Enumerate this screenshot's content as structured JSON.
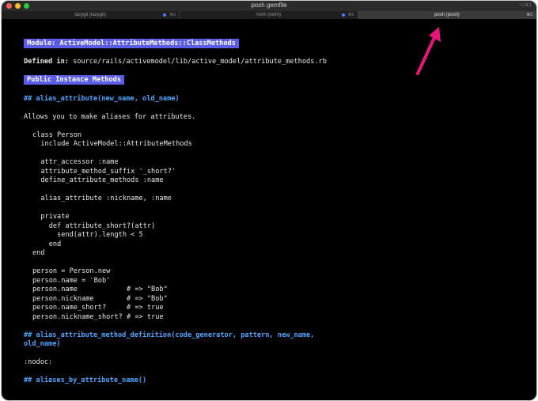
{
  "window": {
    "title": "posh gemfile",
    "shortcut": "⌥⌘1"
  },
  "tabs": [
    {
      "label": "lazygit (lazygit)",
      "shortcut": "⌘1",
      "active": false
    },
    {
      "label": "nvim (nvim)",
      "shortcut": "⌘2",
      "active": false
    },
    {
      "label": "posh (posh)",
      "shortcut": "⌘3",
      "active": true
    }
  ],
  "doc": {
    "module_badge": "Module: ActiveModel::AttributeMethods::ClassMethods",
    "defined_label": "Defined in:",
    "defined_path": "source/rails/activemodel/lib/active_model/attribute_methods.rb",
    "section_badge": "Public Instance Methods",
    "heading1": "## alias_attribute(new_name, old_name)",
    "description": "Allows you to make aliases for attributes.",
    "code": [
      "class Person",
      "  include ActiveModel::AttributeMethods",
      "",
      "  attr_accessor :name",
      "  attribute_method_suffix '_short?'",
      "  define_attribute_methods :name",
      "",
      "  alias_attribute :nickname, :name",
      "",
      "  private",
      "    def attribute_short?(attr)",
      "      send(attr).length < 5",
      "    end",
      "end",
      "",
      "person = Person.new",
      "person.name = 'Bob'",
      "person.name            # => \"Bob\"",
      "person.nickname        # => \"Bob\"",
      "person.name_short?     # => true",
      "person.nickname_short? # => true"
    ],
    "heading2_line1": "## alias_attribute_method_definition(code_generator, pattern, new_name,",
    "heading2_line2": "old_name)",
    "nodoc": ":nodoc:",
    "heading3": "## aliases_by_attribute_name()"
  },
  "colors": {
    "badge": "#5b5de8",
    "heading": "#4fa6ff",
    "arrow": "#e8157a",
    "background": "#000000"
  }
}
